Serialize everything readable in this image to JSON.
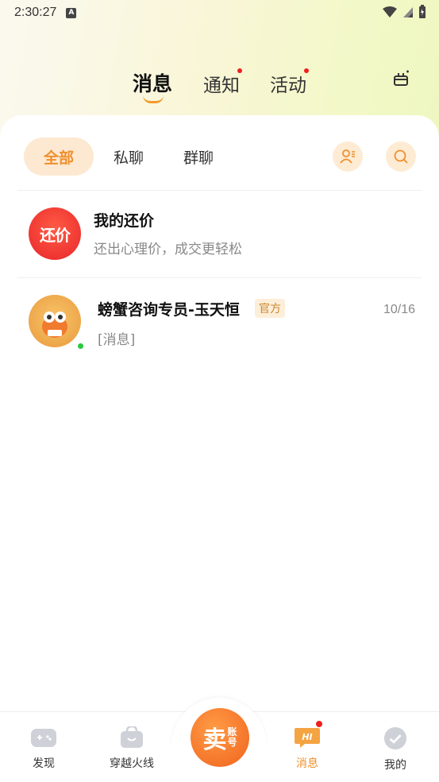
{
  "status_bar": {
    "time": "2:30:27",
    "a_badge": "A"
  },
  "top_tabs": [
    {
      "label": "消息",
      "active": true,
      "dot": false
    },
    {
      "label": "通知",
      "active": false,
      "dot": true
    },
    {
      "label": "活动",
      "active": false,
      "dot": true
    }
  ],
  "filters": [
    {
      "label": "全部",
      "active": true
    },
    {
      "label": "私聊",
      "active": false
    },
    {
      "label": "群聊",
      "active": false
    }
  ],
  "conversations": [
    {
      "title": "我的还价",
      "subtitle": "还出心理价，成交更轻松",
      "avatar_text": "还价",
      "time": "",
      "official_badge": "",
      "online": false
    },
    {
      "title": "螃蟹咨询专员-玉天恒",
      "subtitle": "[消息]",
      "avatar_text": "",
      "time": "10/16",
      "official_badge": "官方",
      "online": true
    }
  ],
  "bottom_nav": [
    {
      "label": "发现",
      "icon": "gamepad-icon",
      "active": false
    },
    {
      "label": "穿越火线",
      "icon": "bag-icon",
      "active": false
    },
    {
      "label": "",
      "icon": "sell-account-button",
      "active": false
    },
    {
      "label": "消息",
      "icon": "hi-chat-icon",
      "active": true,
      "dot": true
    },
    {
      "label": "我的",
      "icon": "profile-icon",
      "active": false
    }
  ],
  "sell_button": {
    "main": "卖",
    "sub1": "账",
    "sub2": "号"
  },
  "colors": {
    "accent": "#f08f2c",
    "dot_red": "#f21f1f",
    "chip_bg": "#fde9d2",
    "online": "#28c840"
  }
}
